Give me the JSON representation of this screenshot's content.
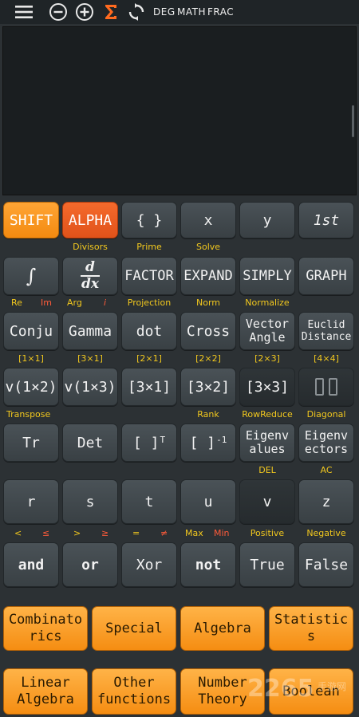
{
  "topbar": {
    "mode_deg": "DEG",
    "mode_math": "MATH",
    "mode_frac": "FRAC",
    "icons": [
      "menu-icon",
      "minus-circle-icon",
      "plus-circle-icon",
      "sigma-icon",
      "refresh-icon"
    ]
  },
  "row1": {
    "shift": "SHIFT",
    "alpha": "ALPHA",
    "braces": "{ }",
    "x": "x",
    "y": "y",
    "first": "1st",
    "above": {
      "divisors": "Divisors",
      "prime": "Prime",
      "solve": "Solve"
    }
  },
  "row2": {
    "integral": "∫",
    "d_top": "d",
    "d_bottom": "dx",
    "factor": "FACTOR",
    "expand": "EXPAND",
    "simply": "SIMPLY",
    "graph": "GRAPH",
    "above": {
      "re": "Re",
      "im": "Im",
      "arg": "Arg",
      "i": "i",
      "projection": "Projection",
      "norm": "Norm",
      "normalize": "Normalize"
    }
  },
  "row3": {
    "conju": "Conju",
    "gamma": "Gamma",
    "dot": "dot",
    "cross": "Cross",
    "vector_angle_1": "Vector",
    "vector_angle_2": "Angle",
    "euclid_1": "Euclid",
    "euclid_2": "Distance",
    "above": {
      "m11": "[1×1]",
      "m31": "[3×1]",
      "m21": "[2×1]",
      "m22": "[2×2]",
      "m23": "[2×3]",
      "m44": "[4×4]"
    }
  },
  "row4": {
    "v12": "v(1×2)",
    "v13": "v(1×3)",
    "m31": "[3×1]",
    "m32": "[3×2]",
    "m33": "[3×3]",
    "above": {
      "transpose": "Transpose",
      "rank": "Rank",
      "rowreduce": "RowReduce",
      "diagonal": "Diagonal"
    }
  },
  "row5": {
    "tr": "Tr",
    "det": "Det",
    "transpose_key": "[ ]",
    "transpose_sup": "T",
    "inverse_key": "[ ]",
    "inverse_sup": "-1",
    "eigenvalues_1": "Eigenv",
    "eigenvalues_2": "alues",
    "eigenvectors_1": "Eigenv",
    "eigenvectors_2": "ectors",
    "above": {
      "del": "DEL",
      "ac": "AC"
    }
  },
  "row6": {
    "r": "r",
    "s": "s",
    "t": "t",
    "u": "u",
    "v": "v",
    "z": "z",
    "above": {
      "lt": "<",
      "le": "≤",
      "gt": ">",
      "ge": "≥",
      "eq": "=",
      "ne": "≠",
      "max": "Max",
      "min": "Min",
      "positive": "Positive",
      "negative": "Negative"
    }
  },
  "row7": {
    "and": "and",
    "or": "or",
    "xor": "Xor",
    "not": "not",
    "true": "True",
    "false": "False"
  },
  "categories": {
    "combinatorics_1": "Combinato",
    "combinatorics_2": "rics",
    "special": "Special",
    "algebra": "Algebra",
    "statistics_1": "Statistic",
    "statistics_2": "s",
    "linear_1": "Linear",
    "linear_2": "Algebra",
    "other_1": "Other",
    "other_2": "functions",
    "number_1": "Number",
    "number_2": "Theory",
    "boolean": "Boolean"
  },
  "watermark": {
    "main": "2265",
    "sub": "手游网"
  },
  "colors": {
    "accent_orange": "#f38a10",
    "alpha_red": "#e0521a",
    "label_yellow": "#f2c81e",
    "label_red": "#ff5b3a"
  }
}
